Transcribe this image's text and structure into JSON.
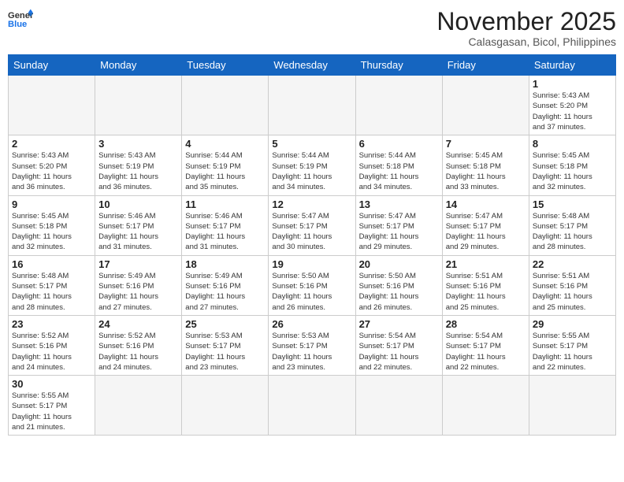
{
  "header": {
    "logo_general": "General",
    "logo_blue": "Blue",
    "month_title": "November 2025",
    "subtitle": "Calasgasan, Bicol, Philippines"
  },
  "weekdays": [
    "Sunday",
    "Monday",
    "Tuesday",
    "Wednesday",
    "Thursday",
    "Friday",
    "Saturday"
  ],
  "weeks": [
    [
      {
        "day": "",
        "info": ""
      },
      {
        "day": "",
        "info": ""
      },
      {
        "day": "",
        "info": ""
      },
      {
        "day": "",
        "info": ""
      },
      {
        "day": "",
        "info": ""
      },
      {
        "day": "",
        "info": ""
      },
      {
        "day": "1",
        "info": "Sunrise: 5:43 AM\nSunset: 5:20 PM\nDaylight: 11 hours\nand 37 minutes."
      }
    ],
    [
      {
        "day": "2",
        "info": "Sunrise: 5:43 AM\nSunset: 5:20 PM\nDaylight: 11 hours\nand 36 minutes."
      },
      {
        "day": "3",
        "info": "Sunrise: 5:43 AM\nSunset: 5:19 PM\nDaylight: 11 hours\nand 36 minutes."
      },
      {
        "day": "4",
        "info": "Sunrise: 5:44 AM\nSunset: 5:19 PM\nDaylight: 11 hours\nand 35 minutes."
      },
      {
        "day": "5",
        "info": "Sunrise: 5:44 AM\nSunset: 5:19 PM\nDaylight: 11 hours\nand 34 minutes."
      },
      {
        "day": "6",
        "info": "Sunrise: 5:44 AM\nSunset: 5:18 PM\nDaylight: 11 hours\nand 34 minutes."
      },
      {
        "day": "7",
        "info": "Sunrise: 5:45 AM\nSunset: 5:18 PM\nDaylight: 11 hours\nand 33 minutes."
      },
      {
        "day": "8",
        "info": "Sunrise: 5:45 AM\nSunset: 5:18 PM\nDaylight: 11 hours\nand 32 minutes."
      }
    ],
    [
      {
        "day": "9",
        "info": "Sunrise: 5:45 AM\nSunset: 5:18 PM\nDaylight: 11 hours\nand 32 minutes."
      },
      {
        "day": "10",
        "info": "Sunrise: 5:46 AM\nSunset: 5:17 PM\nDaylight: 11 hours\nand 31 minutes."
      },
      {
        "day": "11",
        "info": "Sunrise: 5:46 AM\nSunset: 5:17 PM\nDaylight: 11 hours\nand 31 minutes."
      },
      {
        "day": "12",
        "info": "Sunrise: 5:47 AM\nSunset: 5:17 PM\nDaylight: 11 hours\nand 30 minutes."
      },
      {
        "day": "13",
        "info": "Sunrise: 5:47 AM\nSunset: 5:17 PM\nDaylight: 11 hours\nand 29 minutes."
      },
      {
        "day": "14",
        "info": "Sunrise: 5:47 AM\nSunset: 5:17 PM\nDaylight: 11 hours\nand 29 minutes."
      },
      {
        "day": "15",
        "info": "Sunrise: 5:48 AM\nSunset: 5:17 PM\nDaylight: 11 hours\nand 28 minutes."
      }
    ],
    [
      {
        "day": "16",
        "info": "Sunrise: 5:48 AM\nSunset: 5:17 PM\nDaylight: 11 hours\nand 28 minutes."
      },
      {
        "day": "17",
        "info": "Sunrise: 5:49 AM\nSunset: 5:16 PM\nDaylight: 11 hours\nand 27 minutes."
      },
      {
        "day": "18",
        "info": "Sunrise: 5:49 AM\nSunset: 5:16 PM\nDaylight: 11 hours\nand 27 minutes."
      },
      {
        "day": "19",
        "info": "Sunrise: 5:50 AM\nSunset: 5:16 PM\nDaylight: 11 hours\nand 26 minutes."
      },
      {
        "day": "20",
        "info": "Sunrise: 5:50 AM\nSunset: 5:16 PM\nDaylight: 11 hours\nand 26 minutes."
      },
      {
        "day": "21",
        "info": "Sunrise: 5:51 AM\nSunset: 5:16 PM\nDaylight: 11 hours\nand 25 minutes."
      },
      {
        "day": "22",
        "info": "Sunrise: 5:51 AM\nSunset: 5:16 PM\nDaylight: 11 hours\nand 25 minutes."
      }
    ],
    [
      {
        "day": "23",
        "info": "Sunrise: 5:52 AM\nSunset: 5:16 PM\nDaylight: 11 hours\nand 24 minutes."
      },
      {
        "day": "24",
        "info": "Sunrise: 5:52 AM\nSunset: 5:16 PM\nDaylight: 11 hours\nand 24 minutes."
      },
      {
        "day": "25",
        "info": "Sunrise: 5:53 AM\nSunset: 5:17 PM\nDaylight: 11 hours\nand 23 minutes."
      },
      {
        "day": "26",
        "info": "Sunrise: 5:53 AM\nSunset: 5:17 PM\nDaylight: 11 hours\nand 23 minutes."
      },
      {
        "day": "27",
        "info": "Sunrise: 5:54 AM\nSunset: 5:17 PM\nDaylight: 11 hours\nand 22 minutes."
      },
      {
        "day": "28",
        "info": "Sunrise: 5:54 AM\nSunset: 5:17 PM\nDaylight: 11 hours\nand 22 minutes."
      },
      {
        "day": "29",
        "info": "Sunrise: 5:55 AM\nSunset: 5:17 PM\nDaylight: 11 hours\nand 22 minutes."
      }
    ],
    [
      {
        "day": "30",
        "info": "Sunrise: 5:55 AM\nSunset: 5:17 PM\nDaylight: 11 hours\nand 21 minutes."
      },
      {
        "day": "",
        "info": ""
      },
      {
        "day": "",
        "info": ""
      },
      {
        "day": "",
        "info": ""
      },
      {
        "day": "",
        "info": ""
      },
      {
        "day": "",
        "info": ""
      },
      {
        "day": "",
        "info": ""
      }
    ]
  ]
}
